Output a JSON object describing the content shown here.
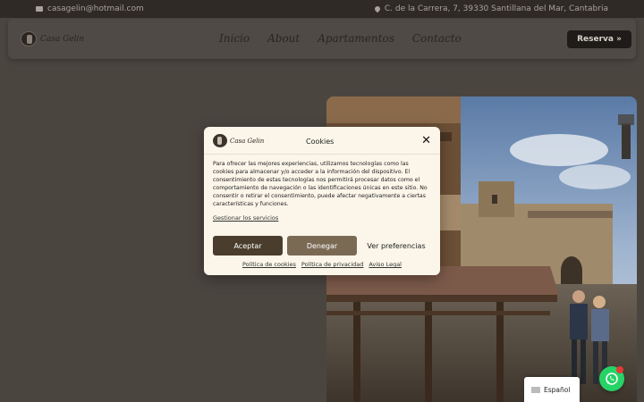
{
  "topbar": {
    "email": "casagelin@hotmail.com",
    "address": "C. de la Carrera, 7, 39330 Santillana del Mar, Cantabria"
  },
  "brand": {
    "name": "Casa Gelin"
  },
  "nav": {
    "items": [
      {
        "label": "Inicio"
      },
      {
        "label": "About"
      },
      {
        "label": "Apartamentos"
      },
      {
        "label": "Contacto"
      }
    ],
    "reserva": "Reserva »"
  },
  "cookies": {
    "title": "Cookies",
    "close": "✕",
    "body": "Para ofrecer las mejores experiencias, utilizamos tecnologías como las cookies para almacenar y/o acceder a la información del dispositivo. El consentimiento de estas tecnologías nos permitirá procesar datos como el comportamiento de navegación o las identificaciones únicas en este sitio. No consentir o retirar el consentimiento, puede afectar negativamente a ciertas características y funciones.",
    "manage": "Gestionar los servicios",
    "accept": "Aceptar",
    "deny": "Denegar",
    "preferences": "Ver preferencias",
    "links": [
      "Política de cookies",
      "Política de privacidad",
      "Aviso Legal"
    ]
  },
  "language": {
    "current": "Español"
  },
  "icons": {
    "email": "mail-icon",
    "address": "location-pin-icon",
    "whatsapp": "whatsapp-icon",
    "flag": "flag-icon"
  },
  "colors": {
    "page_bg": "#4b4540",
    "topbar_bg": "#2f2a26",
    "modal_bg": "#fbf6e9",
    "accept_btn": "#4a3d2d",
    "deny_btn": "#7a6a54",
    "whatsapp": "#25d366"
  }
}
